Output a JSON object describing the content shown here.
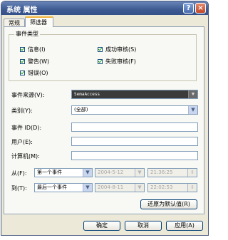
{
  "window": {
    "title": "系统 属性",
    "help_label": "?",
    "close_label": "×"
  },
  "tabs": [
    "常规",
    "筛选器"
  ],
  "event_types": {
    "legend": "事件类型",
    "items": [
      "信息(I)",
      "警告(W)",
      "错误(O)",
      "成功审核(S)",
      "失败审核(F)"
    ]
  },
  "fields": {
    "event_source": {
      "label": "事件来源(V):",
      "value": "SemaAccess"
    },
    "category": {
      "label": "类别(Y):",
      "value": "(全部)"
    },
    "event_id": {
      "label": "事件 ID(D):",
      "value": ""
    },
    "user": {
      "label": "用户(E):",
      "value": ""
    },
    "computer": {
      "label": "计算机(M):",
      "value": ""
    }
  },
  "range": {
    "from": {
      "label": "从(F):",
      "selection": "第一个事件",
      "date": "2004-5-12",
      "time": "21:36:25"
    },
    "to": {
      "label": "到(T):",
      "selection": "最后一个事件",
      "date": "2004-8-11",
      "time": "22:02:53"
    }
  },
  "buttons": {
    "restore_defaults": "还原为默认值(R)",
    "ok": "确定",
    "cancel": "取消",
    "apply": "应用(A)"
  }
}
